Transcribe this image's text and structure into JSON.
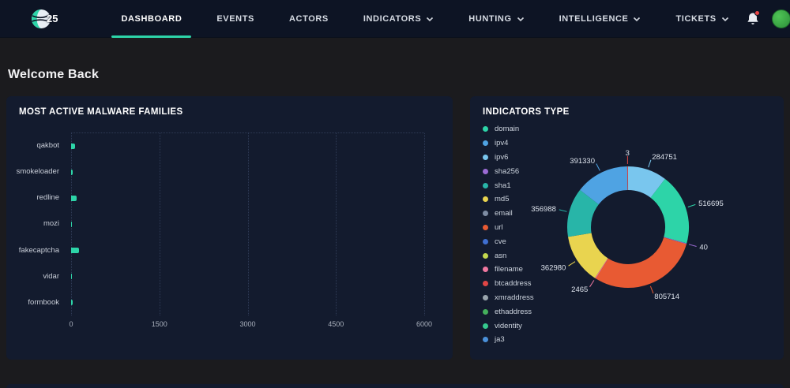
{
  "navbar": {
    "logo_text": "25",
    "items": [
      {
        "label": "DASHBOARD",
        "active": true,
        "has_dropdown": false
      },
      {
        "label": "EVENTS",
        "active": false,
        "has_dropdown": false
      },
      {
        "label": "ACTORS",
        "active": false,
        "has_dropdown": false
      },
      {
        "label": "INDICATORS",
        "active": false,
        "has_dropdown": true
      },
      {
        "label": "HUNTING",
        "active": false,
        "has_dropdown": true
      },
      {
        "label": "INTELLIGENCE",
        "active": false,
        "has_dropdown": true
      },
      {
        "label": "TICKETS",
        "active": false,
        "has_dropdown": true
      }
    ],
    "accent_color": "#2dd4a8",
    "icons": {
      "bell": "notifications-icon",
      "avatar": "user-avatar"
    }
  },
  "page": {
    "heading": "Welcome Back"
  },
  "chart_data": [
    {
      "type": "bar",
      "orientation": "horizontal",
      "title": "MOST ACTIVE MALWARE FAMILIES",
      "categories": [
        "qakbot",
        "smokeloader",
        "redline",
        "mozi",
        "fakecaptcha",
        "vidar",
        "formbook"
      ],
      "values": [
        70,
        30,
        95,
        20,
        140,
        12,
        28
      ],
      "xlim": [
        0,
        6000
      ],
      "xticks": [
        0,
        1500,
        3000,
        4500,
        6000
      ],
      "bar_color": "#2dd4a8",
      "grid": true,
      "legend_position": "none"
    },
    {
      "type": "pie",
      "subtype": "donut",
      "title": "INDICATORS TYPE",
      "legend_position": "left",
      "legend": [
        {
          "label": "domain",
          "color": "#2dd4a8"
        },
        {
          "label": "ipv4",
          "color": "#4fa3e3"
        },
        {
          "label": "ipv6",
          "color": "#79c6ee"
        },
        {
          "label": "sha256",
          "color": "#9b6bd4"
        },
        {
          "label": "sha1",
          "color": "#28b5a8"
        },
        {
          "label": "md5",
          "color": "#e9d44f"
        },
        {
          "label": "email",
          "color": "#7d8ca3"
        },
        {
          "label": "url",
          "color": "#e85a33"
        },
        {
          "label": "cve",
          "color": "#3f6fd1"
        },
        {
          "label": "asn",
          "color": "#c3d84e"
        },
        {
          "label": "filename",
          "color": "#f078a0"
        },
        {
          "label": "btcaddress",
          "color": "#e04545"
        },
        {
          "label": "xmraddress",
          "color": "#9aa5ad"
        },
        {
          "label": "ethaddress",
          "color": "#45b05c"
        },
        {
          "label": "videntity",
          "color": "#35c98e"
        },
        {
          "label": "ja3",
          "color": "#4a90d9"
        }
      ],
      "segments": [
        {
          "label": "ipv6",
          "value": 284751,
          "color": "#79c6ee"
        },
        {
          "label": "domain",
          "value": 516695,
          "color": "#2dd4a8"
        },
        {
          "label": "sha256",
          "value": 40,
          "color": "#9b6bd4"
        },
        {
          "label": "url",
          "value": 805714,
          "color": "#e85a33"
        },
        {
          "label": "filename",
          "value": 2465,
          "color": "#f078a0"
        },
        {
          "label": "md5",
          "value": 362980,
          "color": "#e9d44f"
        },
        {
          "label": "sha1",
          "value": 356988,
          "color": "#28b5a8"
        },
        {
          "label": "ipv4",
          "value": 391330,
          "color": "#4fa3e3"
        },
        {
          "label": "btcaddress",
          "value": 3,
          "color": "#e04545"
        }
      ]
    }
  ]
}
